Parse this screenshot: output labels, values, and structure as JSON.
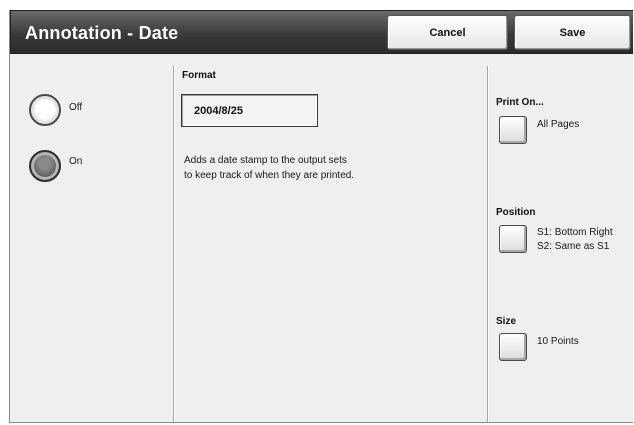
{
  "title": "Annotation - Date",
  "buttons": {
    "cancel": "Cancel",
    "save": "Save"
  },
  "radios": {
    "off": "Off",
    "on": "On",
    "selected": "On"
  },
  "format": {
    "label": "Format",
    "value": "2004/8/25"
  },
  "description": {
    "line1": "Adds a date stamp to the output sets",
    "line2": "to keep track of when they are printed."
  },
  "print_on": {
    "label": "Print On...",
    "value": "All Pages"
  },
  "position": {
    "label": "Position",
    "line1": "S1: Bottom Right",
    "line2": "S2: Same as S1"
  },
  "size": {
    "label": "Size",
    "value": "10 Points"
  }
}
